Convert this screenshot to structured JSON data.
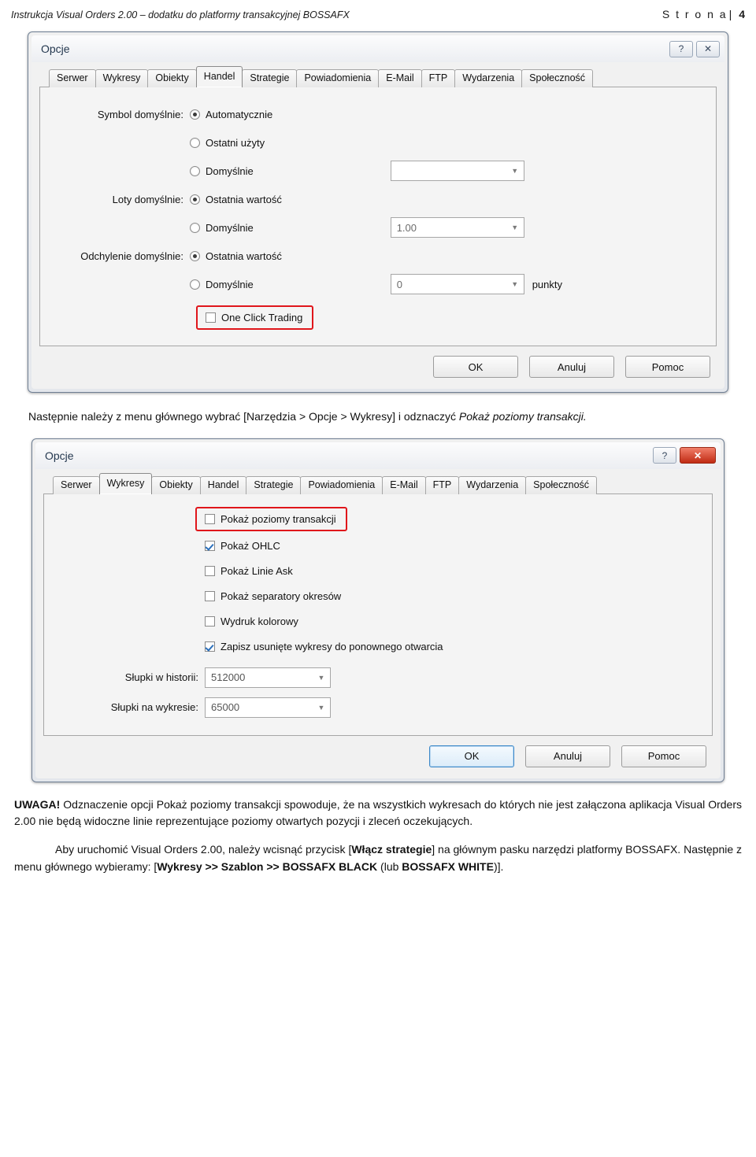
{
  "header": {
    "left_text": "Instrukcja Visual Orders 2.00 – dodatku do platformy transakcyjnej BOSSAFX",
    "page_word": "S t r o n a",
    "separator": "|",
    "page_number": "4"
  },
  "dialog1": {
    "title": "Opcje",
    "help_icon": "?",
    "close_icon": "✕",
    "tabs": [
      {
        "label": "Serwer",
        "active": false
      },
      {
        "label": "Wykresy",
        "active": false
      },
      {
        "label": "Obiekty",
        "active": false
      },
      {
        "label": "Handel",
        "active": true
      },
      {
        "label": "Strategie",
        "active": false
      },
      {
        "label": "Powiadomienia",
        "active": false
      },
      {
        "label": "E-Mail",
        "active": false
      },
      {
        "label": "FTP",
        "active": false
      },
      {
        "label": "Wydarzenia",
        "active": false
      },
      {
        "label": "Społeczność",
        "active": false
      }
    ],
    "rows": [
      {
        "label": "Symbol domyślnie:",
        "options": [
          {
            "text": "Automatycznie",
            "checked": true
          },
          {
            "text": "Ostatni użyty",
            "checked": false
          },
          {
            "text": "Domyślnie",
            "checked": false,
            "combo": "",
            "combo_width": 170
          }
        ]
      },
      {
        "label": "Loty domyślnie:",
        "options": [
          {
            "text": "Ostatnia wartość",
            "checked": true
          },
          {
            "text": "Domyślnie",
            "checked": false,
            "combo": "1.00",
            "combo_width": 170
          }
        ]
      },
      {
        "label": "Odchylenie domyślnie:",
        "options": [
          {
            "text": "Ostatnia wartość",
            "checked": true
          },
          {
            "text": "Domyślnie",
            "checked": false,
            "combo": "0",
            "combo_width": 170,
            "suffix": "punkty"
          }
        ]
      }
    ],
    "one_click": {
      "label": "One Click Trading",
      "checked": false
    },
    "buttons": {
      "ok": "OK",
      "cancel": "Anuluj",
      "help": "Pomoc"
    }
  },
  "middle_paragraph": {
    "text": "Następnie należy z menu głównego wybrać [Narzędzia > Opcje > Wykresy] i odznaczyć ",
    "italic_part": "Pokaż poziomy transakcji."
  },
  "dialog2": {
    "title": "Opcje",
    "help_icon": "?",
    "close_icon": "✕",
    "tabs": [
      {
        "label": "Serwer",
        "active": false
      },
      {
        "label": "Wykresy",
        "active": true
      },
      {
        "label": "Obiekty",
        "active": false
      },
      {
        "label": "Handel",
        "active": false
      },
      {
        "label": "Strategie",
        "active": false
      },
      {
        "label": "Powiadomienia",
        "active": false
      },
      {
        "label": "E-Mail",
        "active": false
      },
      {
        "label": "FTP",
        "active": false
      },
      {
        "label": "Wydarzenia",
        "active": false
      },
      {
        "label": "Społeczność",
        "active": false
      }
    ],
    "checkboxes": [
      {
        "label": "Pokaż poziomy transakcji",
        "checked": false,
        "highlighted": true
      },
      {
        "label": "Pokaż OHLC",
        "checked": true,
        "highlighted": false
      },
      {
        "label": "Pokaż Linie Ask",
        "checked": false,
        "highlighted": false
      },
      {
        "label": "Pokaż separatory okresów",
        "checked": false,
        "highlighted": false
      },
      {
        "label": "Wydruk kolorowy",
        "checked": false,
        "highlighted": false
      },
      {
        "label": "Zapisz usunięte wykresy do ponownego otwarcia",
        "checked": true,
        "highlighted": false
      }
    ],
    "combos": [
      {
        "label": "Słupki w historii:",
        "value": "512000"
      },
      {
        "label": "Słupki na wykresie:",
        "value": "65000"
      }
    ],
    "buttons": {
      "ok": "OK",
      "cancel": "Anuluj",
      "help": "Pomoc"
    }
  },
  "note": {
    "prefix": "UWAGA!",
    "body": " Odznaczenie opcji Pokaż poziomy transakcji spowoduje, że na wszystkich wykresach do których nie jest załączona aplikacja Visual Orders 2.00 nie będą widoczne linie reprezentujące poziomy otwartych pozycji i zleceń oczekujących."
  },
  "final_paragraph": {
    "part1": "Aby uruchomić Visual Orders 2.00, należy wcisnąć przycisk [",
    "bold1": "Włącz strategie",
    "part2": "] na głównym pasku narzędzi platformy BOSSAFX. Następnie z menu głównego wybieramy: [",
    "bold2": "Wykresy >> Szablon >> BOSSAFX BLACK",
    "part3": " (lub ",
    "bold3": "BOSSAFX WHITE",
    "part4": ")]."
  }
}
